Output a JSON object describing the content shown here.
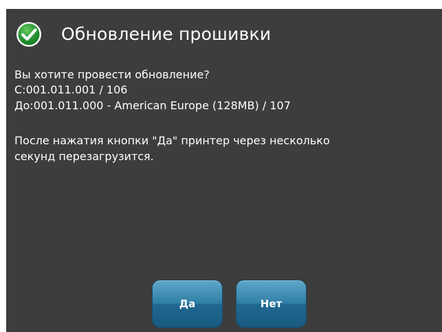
{
  "dialog": {
    "title": "Обновление прошивки",
    "status_icon": "check-icon",
    "question": "Вы хотите провести обновление?",
    "from_version": "С:001.011.001  /  106",
    "to_version": " До:001.011.000 - American Europe (128MB)  /  107",
    "note_line1": "После нажатия кнопки \"Да\" принтер через несколько",
    "note_line2": "секунд перезагрузится."
  },
  "buttons": {
    "yes_label": "Да",
    "no_label": "Нет"
  },
  "colors": {
    "background": "#3d3d3d",
    "accent": "#2f7fa6",
    "check": "#1f9a2e"
  }
}
